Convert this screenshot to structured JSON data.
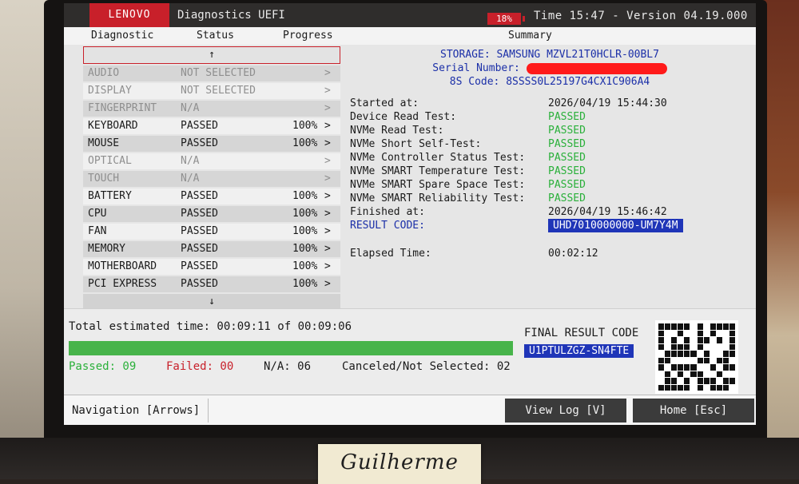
{
  "header": {
    "brand": "LENOVO",
    "title": "Diagnostics UEFI",
    "battery": "18%",
    "time_version": "Time 15:47 - Version 04.19.000"
  },
  "columns": {
    "diagnostic": "Diagnostic",
    "status": "Status",
    "progress": "Progress",
    "summary": "Summary"
  },
  "list": {
    "up_arrow": "↑",
    "down_arrow": "↓",
    "chevron": ">",
    "items": [
      {
        "name": "AUDIO",
        "status": "NOT SELECTED",
        "progress": ""
      },
      {
        "name": "DISPLAY",
        "status": "NOT SELECTED",
        "progress": ""
      },
      {
        "name": "FINGERPRINT",
        "status": "N/A",
        "progress": ""
      },
      {
        "name": "KEYBOARD",
        "status": "PASSED",
        "progress": "100%"
      },
      {
        "name": "MOUSE",
        "status": "PASSED",
        "progress": "100%"
      },
      {
        "name": "OPTICAL",
        "status": "N/A",
        "progress": ""
      },
      {
        "name": "TOUCH",
        "status": "N/A",
        "progress": ""
      },
      {
        "name": "BATTERY",
        "status": "PASSED",
        "progress": "100%"
      },
      {
        "name": "CPU",
        "status": "PASSED",
        "progress": "100%"
      },
      {
        "name": "FAN",
        "status": "PASSED",
        "progress": "100%"
      },
      {
        "name": "MEMORY",
        "status": "PASSED",
        "progress": "100%"
      },
      {
        "name": "MOTHERBOARD",
        "status": "PASSED",
        "progress": "100%"
      },
      {
        "name": "PCI EXPRESS",
        "status": "PASSED",
        "progress": "100%"
      }
    ]
  },
  "summary": {
    "storage": "STORAGE: SAMSUNG MZVL21T0HCLR-00BL7",
    "serial_label": "Serial Number:",
    "code_8s": "8S Code: 8SSSS0L25197G4CX1C906A4",
    "started_label": "Started at:",
    "started_value": "2026/04/19 15:44:30",
    "tests": [
      {
        "name": "Device Read Test:",
        "result": "PASSED"
      },
      {
        "name": "NVMe Read Test:",
        "result": "PASSED"
      },
      {
        "name": "NVMe Short Self-Test:",
        "result": "PASSED"
      },
      {
        "name": "NVMe Controller Status Test:",
        "result": "PASSED"
      },
      {
        "name": "NVMe SMART Temperature Test:",
        "result": "PASSED"
      },
      {
        "name": "NVMe SMART Spare Space Test:",
        "result": "PASSED"
      },
      {
        "name": "NVMe SMART Reliability Test:",
        "result": "PASSED"
      }
    ],
    "finished_label": "Finished at:",
    "finished_value": "2026/04/19 15:46:42",
    "result_code_label": "RESULT CODE:",
    "result_code_value": "UHD7010000000-UM7Y4M",
    "elapsed_label": "Elapsed Time:",
    "elapsed_value": "00:02:12"
  },
  "bottom": {
    "total_time": "Total estimated time: 00:09:11 of 00:09:06",
    "progress_fraction": 1.0,
    "passed": "Passed: 09",
    "failed": "Failed: 00",
    "na": "N/A: 06",
    "canceled": "Canceled/Not Selected: 02",
    "final_label": "FINAL RESULT CODE",
    "final_code": "U1PTULZGZ-SN4FTE"
  },
  "footer": {
    "navigation": "Navigation [Arrows]",
    "view_log": "View Log [V]",
    "home": "Home [Esc]"
  },
  "sticky_note": "Guilherme",
  "colors": {
    "brand_red": "#c8202a",
    "pass_green": "#2ab03a",
    "code_blue": "#1f35b8",
    "fail_red": "#c8202a"
  }
}
